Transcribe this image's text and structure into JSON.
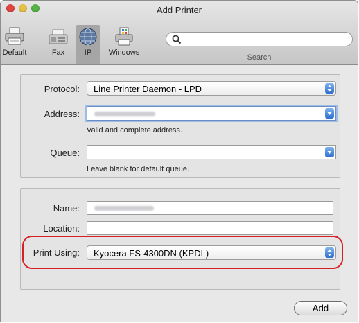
{
  "window": {
    "title": "Add Printer"
  },
  "toolbar": {
    "tools": [
      {
        "label": "Default",
        "icon": "default-printer-icon"
      },
      {
        "label": "Fax",
        "icon": "fax-icon"
      },
      {
        "label": "IP",
        "icon": "globe-icon"
      },
      {
        "label": "Windows",
        "icon": "windows-printer-icon"
      }
    ],
    "selected": "IP",
    "search": {
      "label": "Search",
      "placeholder": "",
      "value": ""
    }
  },
  "connection": {
    "protocol_label": "Protocol:",
    "protocol_value": "Line Printer Daemon - LPD",
    "address_label": "Address:",
    "address_hint": "Valid and complete address.",
    "queue_label": "Queue:",
    "queue_value": "",
    "queue_hint": "Leave blank for default queue."
  },
  "details": {
    "name_label": "Name:",
    "location_label": "Location:",
    "location_value": "",
    "print_using_label": "Print Using:",
    "print_using_value": "Kyocera FS-4300DN (KPDL)"
  },
  "footer": {
    "add_label": "Add"
  },
  "colors": {
    "highlight": "#d71f26",
    "accent": "#2d6fd2",
    "close": "#e0453f",
    "minimize": "#e6c147",
    "zoom": "#57b247"
  }
}
